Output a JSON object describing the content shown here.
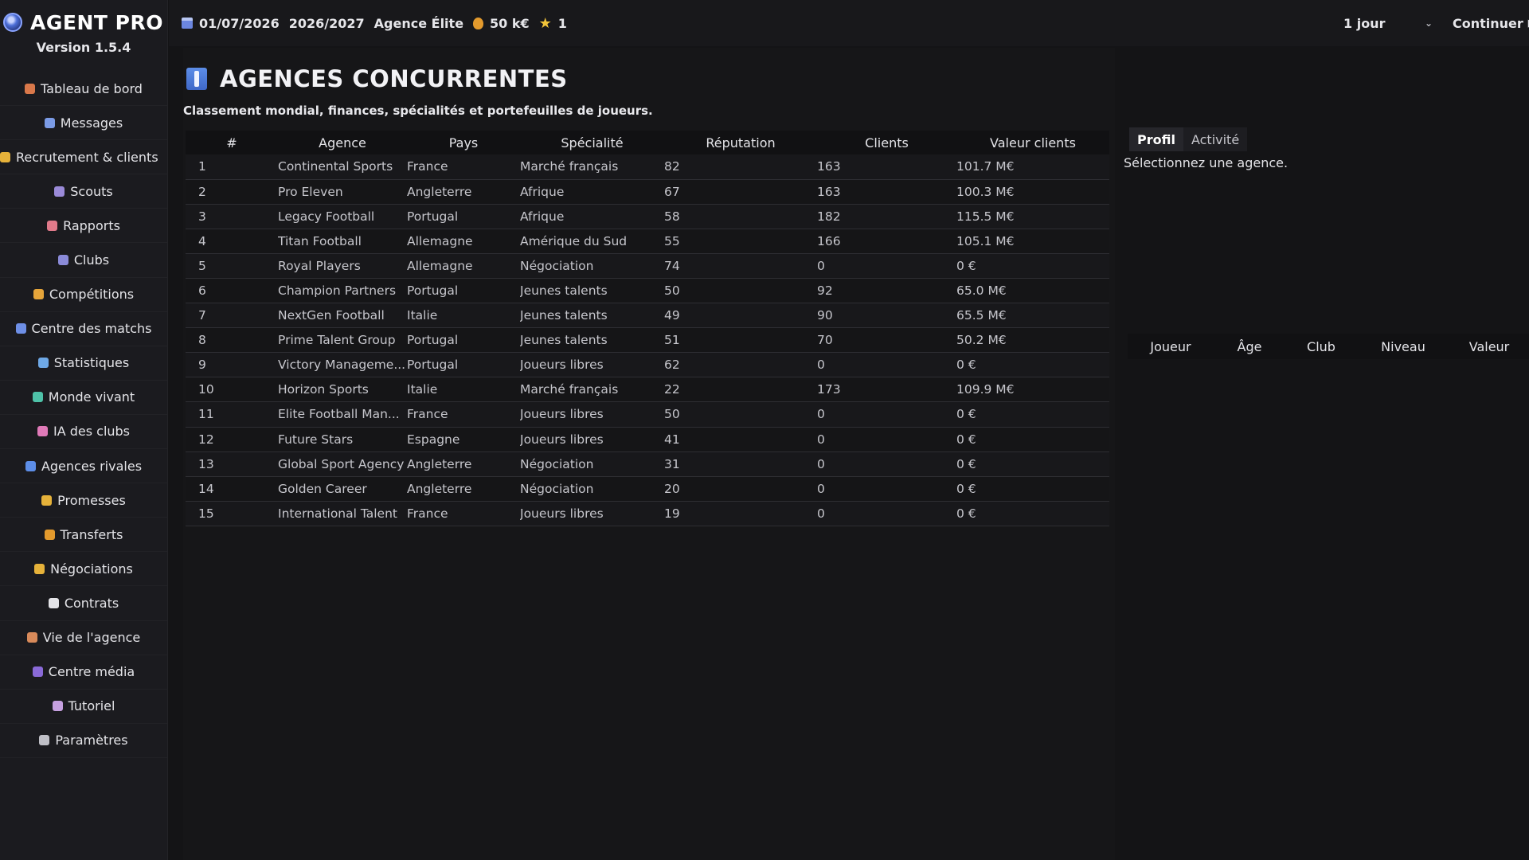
{
  "app": {
    "title": "AGENT PRO",
    "version": "Version 1.5.4"
  },
  "sidebar": {
    "items": [
      {
        "label": "Tableau de bord",
        "icon": "home-icon",
        "color": "#d9784a"
      },
      {
        "label": "Messages",
        "icon": "mail-icon",
        "color": "#7b9be6"
      },
      {
        "label": "Recrutement & clients",
        "icon": "handshake-icon",
        "color": "#e6b23a"
      },
      {
        "label": "Scouts",
        "icon": "scout-icon",
        "color": "#9a8ad8"
      },
      {
        "label": "Rapports",
        "icon": "report-icon",
        "color": "#e07a8a"
      },
      {
        "label": "Clubs",
        "icon": "stadium-icon",
        "color": "#8a8ad8"
      },
      {
        "label": "Compétitions",
        "icon": "trophy-icon",
        "color": "#e6a53a"
      },
      {
        "label": "Centre des matchs",
        "icon": "ball-icon",
        "color": "#6e8fe6"
      },
      {
        "label": "Statistiques",
        "icon": "chart-icon",
        "color": "#6ea8e6"
      },
      {
        "label": "Monde vivant",
        "icon": "globe-icon",
        "color": "#4ec2a8"
      },
      {
        "label": "IA des clubs",
        "icon": "brain-icon",
        "color": "#e07ab8"
      },
      {
        "label": "Agences rivales",
        "icon": "agency-icon",
        "color": "#5d8ee8"
      },
      {
        "label": "Promesses",
        "icon": "promise-icon",
        "color": "#e6b23a"
      },
      {
        "label": "Transferts",
        "icon": "money-bag-icon",
        "color": "#e39a2d"
      },
      {
        "label": "Négociations",
        "icon": "negotiation-icon",
        "color": "#e6b23a"
      },
      {
        "label": "Contrats",
        "icon": "document-icon",
        "color": "#e4e4e8"
      },
      {
        "label": "Vie de l'agence",
        "icon": "person-icon",
        "color": "#d88a5a"
      },
      {
        "label": "Centre média",
        "icon": "media-icon",
        "color": "#8a6ad8"
      },
      {
        "label": "Tutoriel",
        "icon": "pointer-icon",
        "color": "#c6a0e0"
      },
      {
        "label": "Paramètres",
        "icon": "gear-icon",
        "color": "#bfbfc6"
      }
    ]
  },
  "topbar": {
    "date": "01/07/2026",
    "season": "2026/2027",
    "agency_tier": "Agence Élite",
    "budget": "50 k€",
    "stars": "1",
    "speed": "1 jour",
    "continue_label": "Continuer"
  },
  "page": {
    "title": "AGENCES CONCURRENTES",
    "subtitle": "Classement mondial, finances, spécialités et portefeuilles de joueurs."
  },
  "table": {
    "columns": [
      "#",
      "Agence",
      "Pays",
      "Spécialité",
      "Réputation",
      "Clients",
      "Valeur clients"
    ],
    "rows": [
      [
        "1",
        "Continental Sports",
        "France",
        "Marché français",
        "82",
        "163",
        "101.7 M€"
      ],
      [
        "2",
        "Pro Eleven",
        "Angleterre",
        "Afrique",
        "67",
        "163",
        "100.3 M€"
      ],
      [
        "3",
        "Legacy Football",
        "Portugal",
        "Afrique",
        "58",
        "182",
        "115.5 M€"
      ],
      [
        "4",
        "Titan Football",
        "Allemagne",
        "Amérique du Sud",
        "55",
        "166",
        "105.1 M€"
      ],
      [
        "5",
        "Royal Players",
        "Allemagne",
        "Négociation",
        "74",
        "0",
        "0 €"
      ],
      [
        "6",
        "Champion Partners",
        "Portugal",
        "Jeunes talents",
        "50",
        "92",
        "65.0 M€"
      ],
      [
        "7",
        "NextGen Football",
        "Italie",
        "Jeunes talents",
        "49",
        "90",
        "65.5 M€"
      ],
      [
        "8",
        "Prime Talent Group",
        "Portugal",
        "Jeunes talents",
        "51",
        "70",
        "50.2 M€"
      ],
      [
        "9",
        "Victory Manageme...",
        "Portugal",
        "Joueurs libres",
        "62",
        "0",
        "0 €"
      ],
      [
        "10",
        "Horizon Sports",
        "Italie",
        "Marché français",
        "22",
        "173",
        "109.9 M€"
      ],
      [
        "11",
        "Elite Football Man...",
        "France",
        "Joueurs libres",
        "50",
        "0",
        "0 €"
      ],
      [
        "12",
        "Future Stars",
        "Espagne",
        "Joueurs libres",
        "41",
        "0",
        "0 €"
      ],
      [
        "13",
        "Global Sport Agency",
        "Angleterre",
        "Négociation",
        "31",
        "0",
        "0 €"
      ],
      [
        "14",
        "Golden Career",
        "Angleterre",
        "Négociation",
        "20",
        "0",
        "0 €"
      ],
      [
        "15",
        "International Talent",
        "France",
        "Joueurs libres",
        "19",
        "0",
        "0 €"
      ]
    ]
  },
  "panel": {
    "tabs": [
      "Profil",
      "Activité"
    ],
    "hint": "Sélectionnez une agence.",
    "players_columns": [
      "Joueur",
      "Âge",
      "Club",
      "Niveau",
      "Valeur"
    ]
  }
}
